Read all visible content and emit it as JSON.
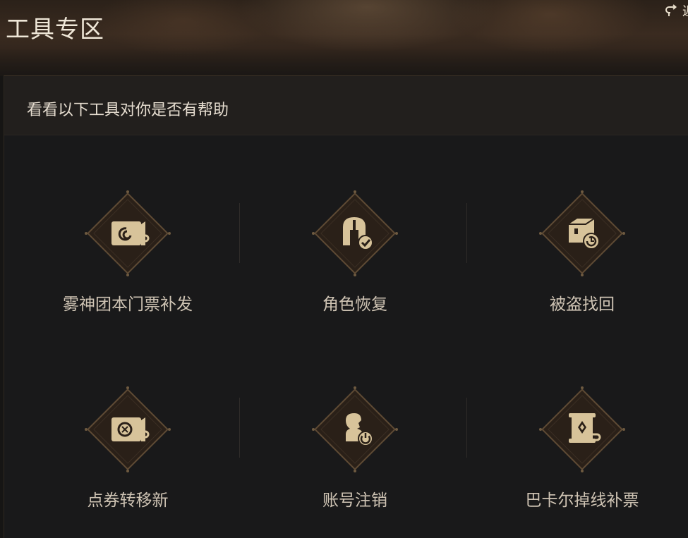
{
  "header": {
    "title": "工具专区",
    "back_label": "返回"
  },
  "panel": {
    "subtitle": "看看以下工具对你是否有帮助"
  },
  "tools": [
    {
      "label": "雾神团本门票补发",
      "icon": "ticket-swirl-icon"
    },
    {
      "label": "角色恢复",
      "icon": "helmet-check-icon"
    },
    {
      "label": "被盗找回",
      "icon": "chest-restore-icon"
    },
    {
      "label": "点券转移新",
      "icon": "ticket-transfer-icon"
    },
    {
      "label": "账号注销",
      "icon": "user-power-icon"
    },
    {
      "label": "巴卡尔掉线补票",
      "icon": "scroll-diamond-icon"
    }
  ],
  "colors": {
    "accent_gold": "#d7c39a",
    "icon_bg": "#2a2018",
    "icon_border": "#5e4a34"
  }
}
